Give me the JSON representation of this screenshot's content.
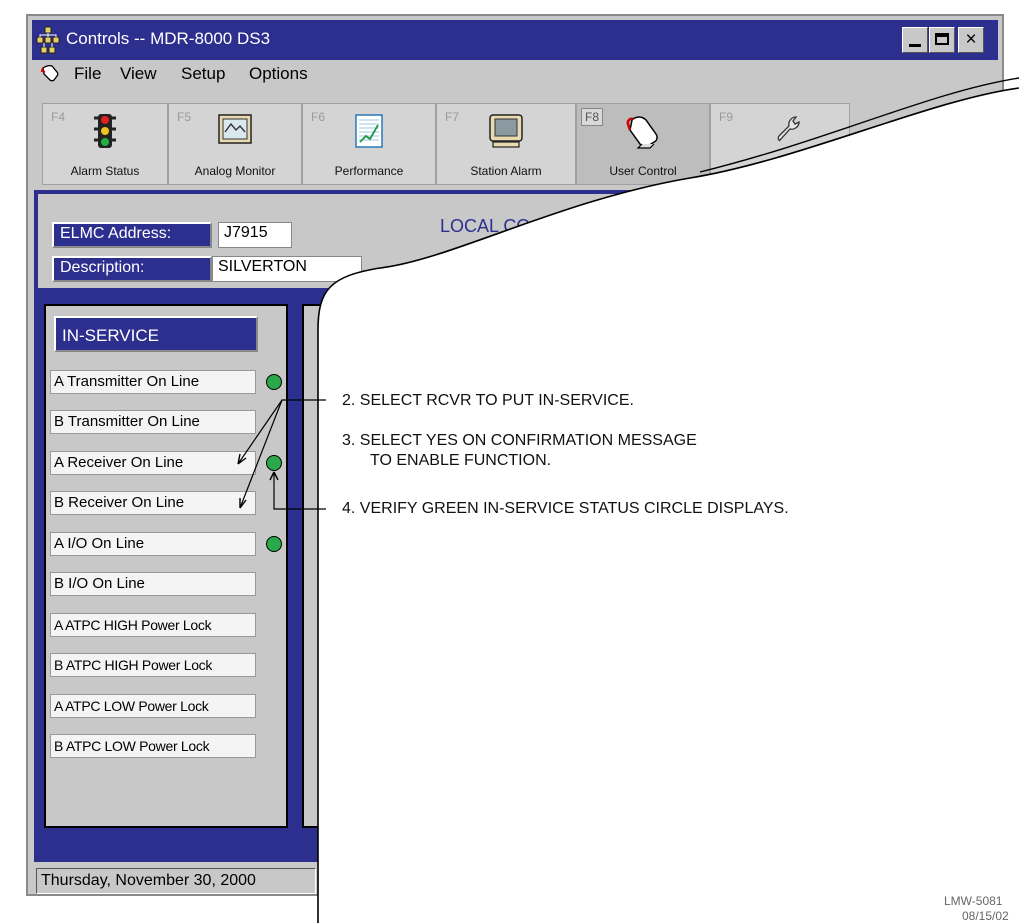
{
  "window": {
    "title": "Controls -- MDR-8000 DS3",
    "controls": [
      "_",
      "□",
      "×"
    ]
  },
  "menu": [
    "File",
    "View",
    "Setup",
    "Options"
  ],
  "tabs": [
    {
      "key": "F4",
      "label": "Alarm Status",
      "icon": "traffic-light-icon"
    },
    {
      "key": "F5",
      "label": "Analog Monitor",
      "icon": "waveform-monitor-icon"
    },
    {
      "key": "F6",
      "label": "Performance",
      "icon": "performance-chart-icon"
    },
    {
      "key": "F7",
      "label": "Station Alarm",
      "icon": "monitor-icon"
    },
    {
      "key": "F8",
      "label": "User Control",
      "icon": "hand-pointer-icon"
    },
    {
      "key": "F9",
      "label": "",
      "icon": "wrench-icon"
    }
  ],
  "header": {
    "elmc_label": "ELMC Address:",
    "elmc_value": "J7915",
    "description_label": "Description:",
    "description_value": "SILVERTON",
    "mode_title": "LOCAL CO"
  },
  "inservice": {
    "title": "IN-SERVICE",
    "items": [
      {
        "label": "A Transmitter On Line",
        "led": true
      },
      {
        "label": "B Transmitter On Line",
        "led": false
      },
      {
        "label": "A Receiver On Line",
        "led": true
      },
      {
        "label": "B Receiver On Line",
        "led": false
      },
      {
        "label": "A I/O On Line",
        "led": true
      },
      {
        "label": "B I/O On Line",
        "led": false
      },
      {
        "label": "A ATPC HIGH Power Lock",
        "led": false
      },
      {
        "label": "B ATPC HIGH Power Lock",
        "led": false
      },
      {
        "label": "A ATPC LOW Power Lock",
        "led": false
      },
      {
        "label": "B ATPC LOW Power Lock",
        "led": false
      }
    ]
  },
  "status_date": "Thursday, November 30, 2000",
  "callouts": [
    "2.  SELECT RCVR TO PUT IN-SERVICE.",
    "3.  SELECT YES ON CONFIRMATION MESSAGE",
    "TO ENABLE FUNCTION.",
    "4.  VERIFY GREEN IN-SERVICE STATUS CIRCLE DISPLAYS."
  ],
  "reference": {
    "code": "LMW-5081",
    "date": "08/15/02"
  },
  "colors": {
    "title_blue": "#2d2f8f",
    "window_gray": "#c8c8c8",
    "led_green": "#2aa84a"
  }
}
